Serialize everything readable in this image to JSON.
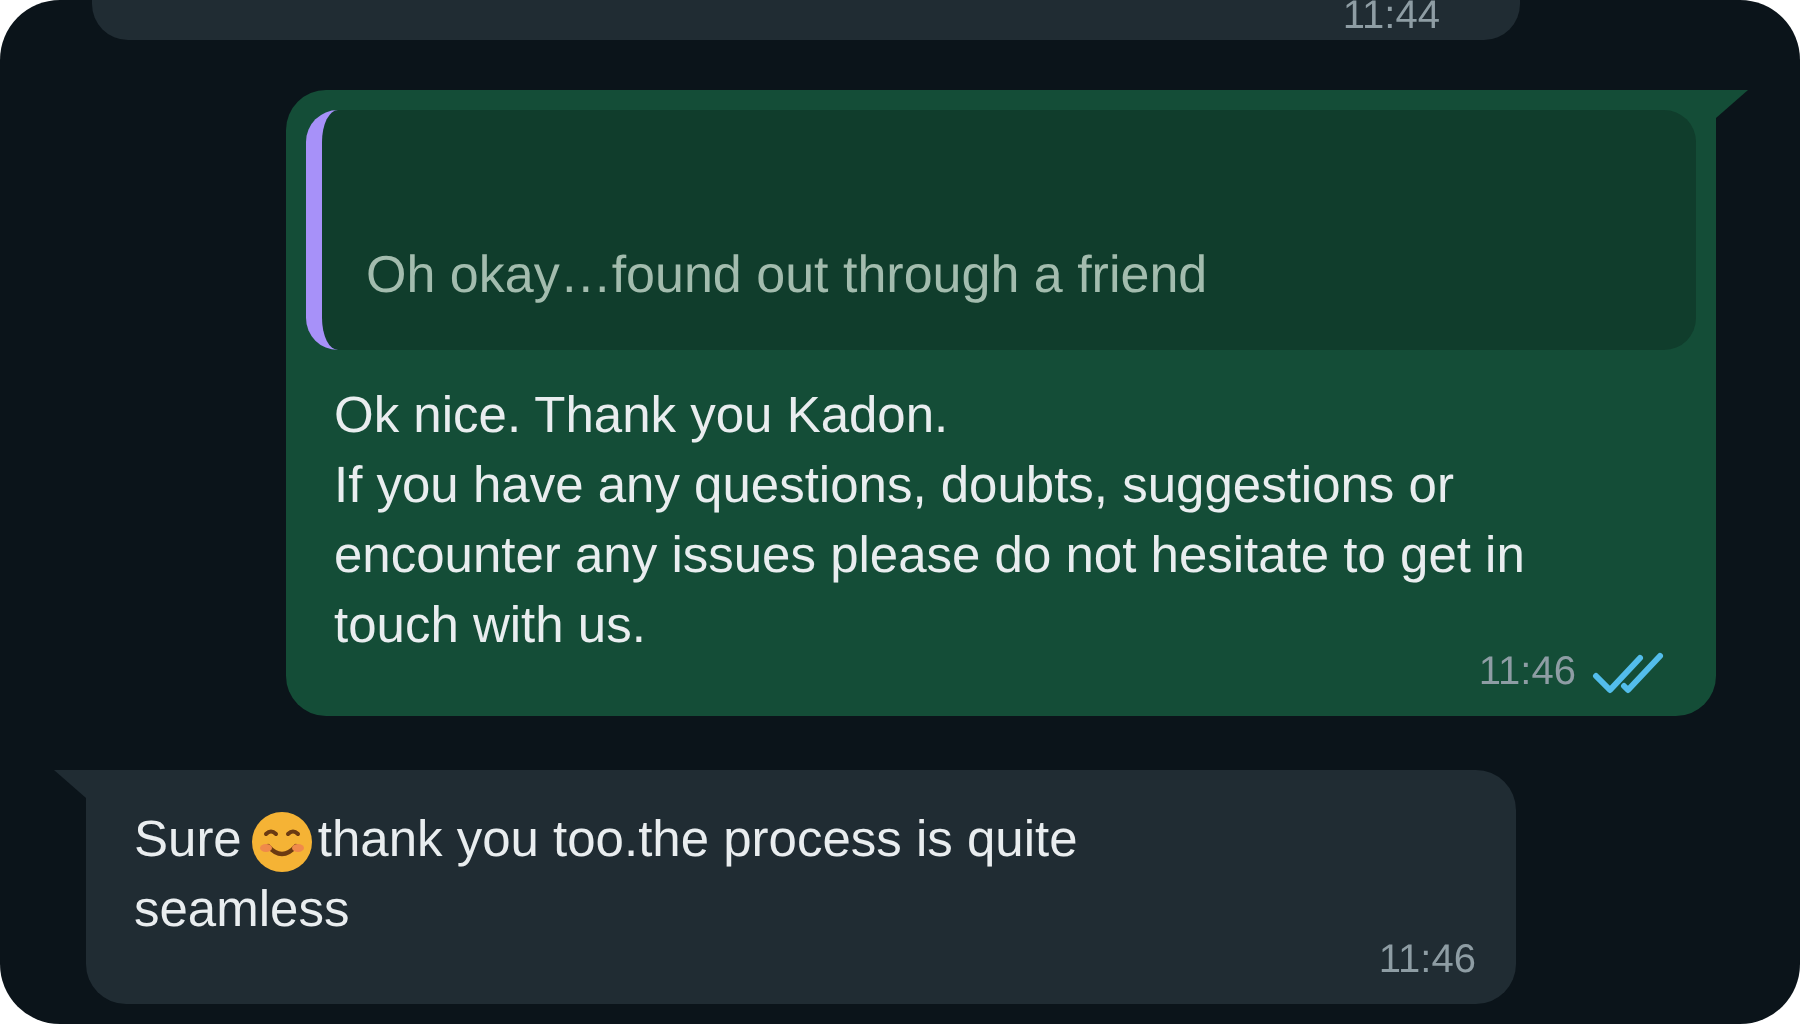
{
  "messages": [
    {
      "kind": "incoming",
      "time": "11:44"
    },
    {
      "kind": "outgoing",
      "quote": {
        "text": "Oh okay…found out through a friend"
      },
      "lines": [
        "Ok nice. Thank you Kadon.",
        "If you have any questions, doubts, suggestions or encounter any issues please do not hesitate to get in touch with us."
      ],
      "time": "11:46",
      "read": true
    },
    {
      "kind": "incoming",
      "text_before": "Sure",
      "text_after": [
        "thank you too.the process is quite",
        "seamless"
      ],
      "time": "11:46"
    }
  ]
}
